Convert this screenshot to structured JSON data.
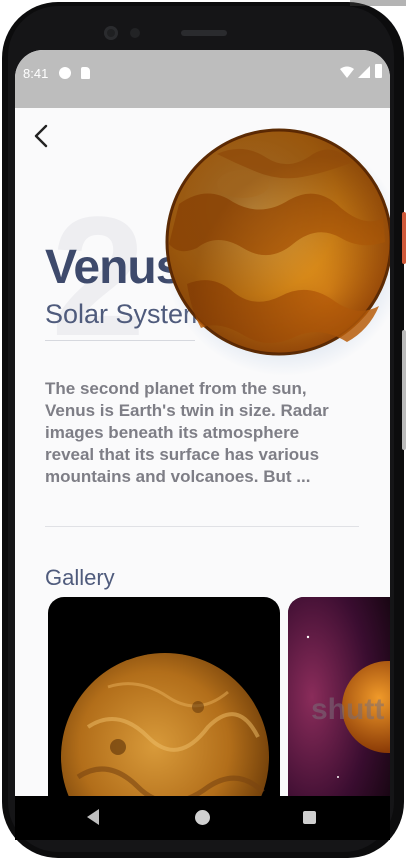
{
  "status_bar": {
    "time": "8:41"
  },
  "planet": {
    "number": "2",
    "name": "Venus",
    "subtitle": "Solar System",
    "description": "The second planet from the sun, Venus is Earth's twin in size. Radar images beneath its atmosphere reveal that its surface has various mountains and volcanoes. But ..."
  },
  "gallery": {
    "title": "Gallery",
    "watermark": "shutt"
  },
  "colors": {
    "title": "#3e4a6c",
    "subtitle": "#4f5b7c",
    "body_text": "#7e7e86",
    "planet_orange": "#e38b15"
  },
  "icons": {
    "back": "arrow-left-icon",
    "nav_back": "triangle-back-icon",
    "nav_home": "circle-home-icon",
    "nav_recent": "square-recents-icon"
  }
}
